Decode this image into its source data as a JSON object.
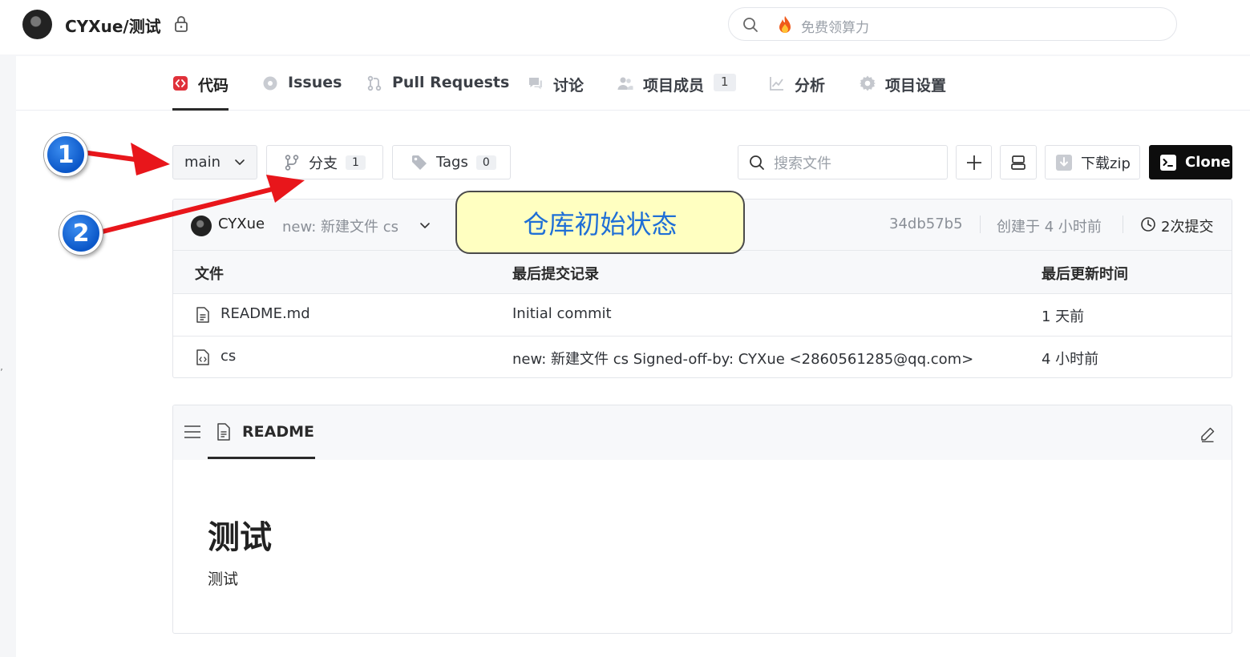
{
  "header": {
    "repo_title": "CYXue/测试",
    "search_placeholder": "免费领算力"
  },
  "tabs": [
    {
      "label": "代码"
    },
    {
      "label": "Issues"
    },
    {
      "label": "Pull Requests"
    },
    {
      "label": "讨论"
    },
    {
      "label": "项目成员",
      "badge": "1"
    },
    {
      "label": "分析"
    },
    {
      "label": "项目设置"
    }
  ],
  "toolbar": {
    "branch": "main",
    "branches_label": "分支",
    "branches_count": "1",
    "tags_label": "Tags",
    "tags_count": "0",
    "file_search_placeholder": "搜索文件",
    "download_label": "下载zip",
    "clone_label": "Clone"
  },
  "latest_commit": {
    "author": "CYXue",
    "message": "new: 新建文件 cs",
    "hash": "34db57b5",
    "created": "创建于 4 小时前",
    "commit_count": "2次提交"
  },
  "file_table": {
    "headers": [
      "文件",
      "最后提交记录",
      "最后更新时间"
    ],
    "rows": [
      {
        "name": "README.md",
        "commit": "Initial commit",
        "updated": "1 天前"
      },
      {
        "name": "cs",
        "commit": "new: 新建文件 cs Signed-off-by: CYXue <2860561285@qq.com>",
        "updated": "4 小时前"
      }
    ]
  },
  "readme": {
    "tab_label": "README",
    "heading": "测试",
    "body": "测试"
  },
  "annotations": {
    "callout": "仓库初始状态",
    "marker_1": "1",
    "marker_2": "2"
  },
  "colors": {
    "accent_red": "#e0313a",
    "marker_blue": "#0b57c8",
    "callout_bg": "#ffffc1",
    "callout_text": "#1f6fd6",
    "arrow_red": "#e8161b"
  }
}
